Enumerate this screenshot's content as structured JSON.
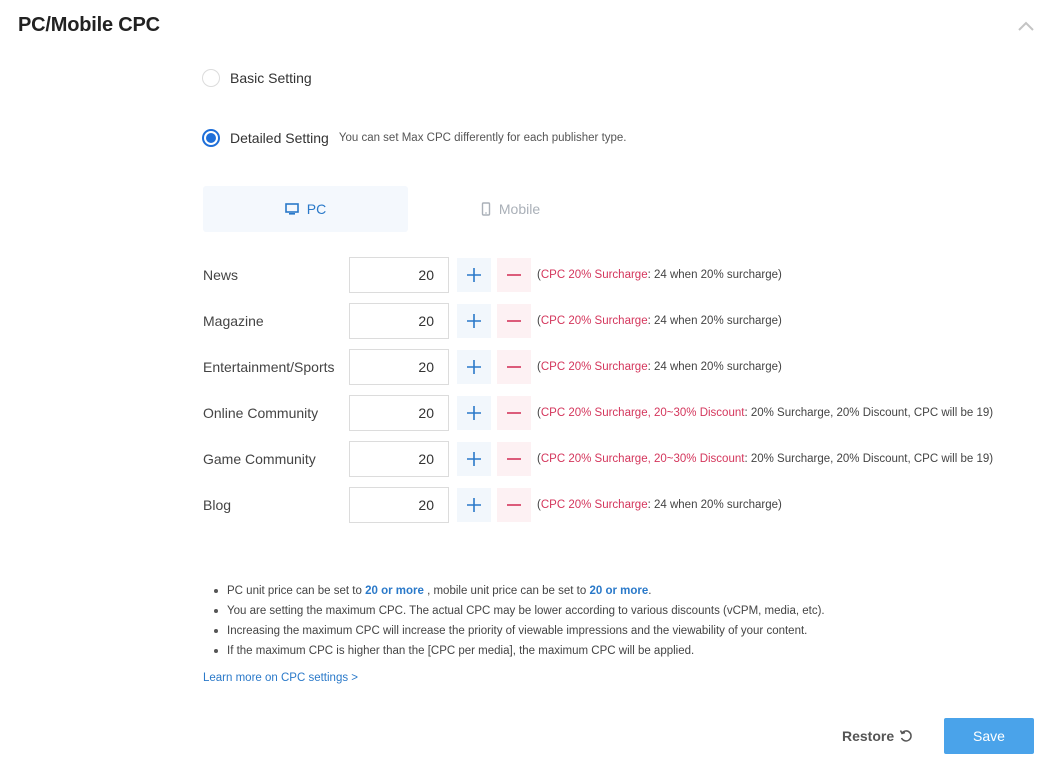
{
  "section": {
    "title": "PC/Mobile CPC",
    "collapse_icon": "chevron-up-icon"
  },
  "settings": {
    "basic_label": "Basic Setting",
    "detailed_label": "Detailed Setting",
    "detailed_hint": "You can set Max CPC differently for each publisher type.",
    "selected": "detailed"
  },
  "tabs": [
    {
      "label": "PC",
      "icon": "monitor-icon",
      "active": true
    },
    {
      "label": "Mobile",
      "icon": "phone-icon",
      "active": false
    }
  ],
  "rows": [
    {
      "label": "News",
      "value": "20",
      "note_open": "(",
      "note_red": "CPC 20% Surcharge",
      "note_rest": ": 24 when 20% surcharge)"
    },
    {
      "label": "Magazine",
      "value": "20",
      "note_open": "(",
      "note_red": "CPC 20% Surcharge",
      "note_rest": ": 24 when 20% surcharge)"
    },
    {
      "label": "Entertainment/Sports",
      "value": "20",
      "note_open": "(",
      "note_red": "CPC 20% Surcharge",
      "note_rest": ": 24 when 20% surcharge)"
    },
    {
      "label": "Online Community",
      "value": "20",
      "note_open": "(",
      "note_red": "CPC 20% Surcharge, 20~30% Discount",
      "note_rest": ": 20% Surcharge, 20% Discount, CPC will be 19)"
    },
    {
      "label": "Game Community",
      "value": "20",
      "note_open": "(",
      "note_red": "CPC 20% Surcharge, 20~30% Discount",
      "note_rest": ": 20% Surcharge, 20% Discount, CPC will be 19)"
    },
    {
      "label": "Blog",
      "value": "20",
      "note_open": "(",
      "note_red": "CPC 20% Surcharge",
      "note_rest": ": 24 when 20% surcharge)"
    }
  ],
  "notes": {
    "line1_a": "PC unit price can be set to ",
    "line1_b": "20 or more",
    "line1_c": " , mobile unit price can be set to ",
    "line1_d": "20 or more",
    "line1_e": ".",
    "line2": "You are setting the maximum CPC. The actual CPC may be lower according to various discounts (vCPM, media, etc).",
    "line3": "Increasing the maximum CPC will increase the priority of viewable impressions and the viewability of your content.",
    "line4": "If the maximum CPC is higher than the [CPC per media], the maximum CPC will be applied."
  },
  "learn_more": "Learn more on CPC settings >",
  "footer": {
    "restore_label": "Restore",
    "save_label": "Save"
  },
  "colors": {
    "accent": "#1e6fd9",
    "blue_text": "#2a79c9",
    "red_text": "#d4365c",
    "save_bg": "#4aa3ea"
  }
}
